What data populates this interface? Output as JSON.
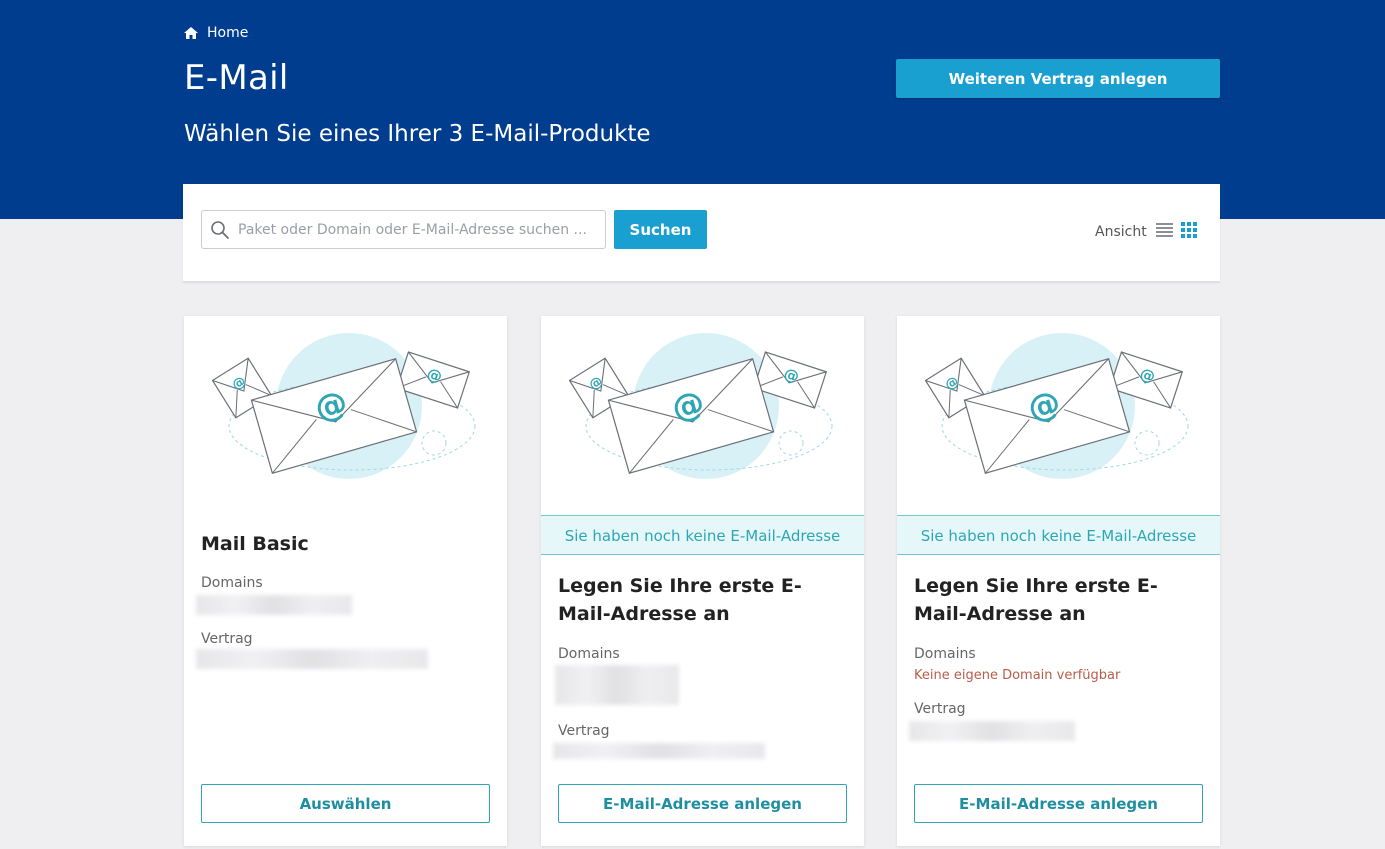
{
  "header": {
    "breadcrumb_home": "Home",
    "title": "E-Mail",
    "subtitle": "Wählen Sie eines Ihrer 3 E-Mail-Produkte",
    "new_contract_label": "Weiteren Vertrag anlegen"
  },
  "search": {
    "placeholder": "Paket oder Domain oder E-Mail-Adresse suchen ...",
    "button_label": "Suchen",
    "view_label": "Ansicht"
  },
  "cards": [
    {
      "title": "Mail Basic",
      "domains_label": "Domains",
      "contract_label": "Vertrag",
      "action_label": "Auswählen"
    },
    {
      "banner": "Sie haben noch keine E-Mail-Adresse",
      "title": "Legen Sie Ihre erste E-Mail-Adresse an",
      "domains_label": "Domains",
      "contract_label": "Vertrag",
      "action_label": "E-Mail-Adresse anlegen"
    },
    {
      "banner": "Sie haben noch keine E-Mail-Adresse",
      "title": "Legen Sie Ihre erste E-Mail-Adresse an",
      "domains_label": "Domains",
      "domains_note": "Keine eigene Domain verfügbar",
      "contract_label": "Vertrag",
      "action_label": "E-Mail-Adresse anlegen"
    }
  ],
  "icons": {
    "breadcrumb": "home-icon",
    "search": "search-icon",
    "list_view": "list-view-icon",
    "grid_view": "grid-view-icon",
    "illustration": "email-envelopes-illustration"
  },
  "colors": {
    "hero_bg": "#003d8f",
    "primary": "#1a9fd1",
    "accent_teal": "#2ea6b4",
    "banner_bg": "#e6f7f9",
    "error_text": "#b85c4a"
  }
}
